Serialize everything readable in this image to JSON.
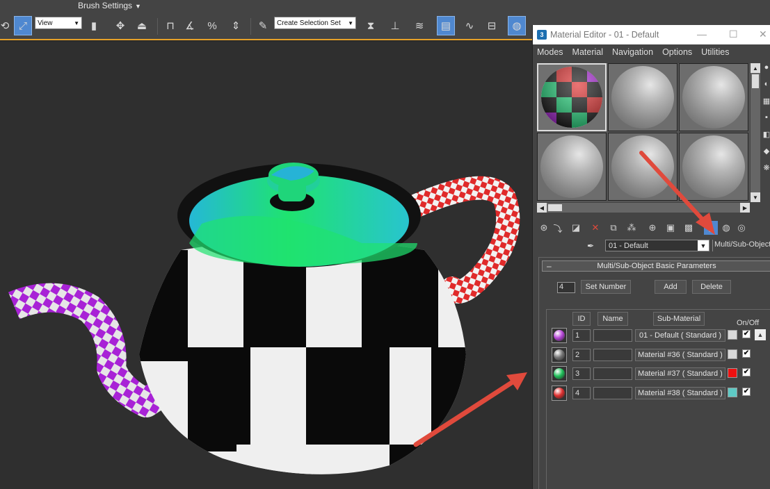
{
  "ribbon": {
    "brush_settings_label": "Brush Settings"
  },
  "toolbar": {
    "view_select": "View",
    "selection_set_select": "Create Selection Set"
  },
  "material_editor": {
    "title": "Material Editor - 01 - Default",
    "menu": [
      "Modes",
      "Material",
      "Navigation",
      "Options",
      "Utilities"
    ],
    "material_name": "01 - Default",
    "material_type": "Multi/Sub-Object",
    "rollout_title": "Multi/Sub-Object Basic Parameters",
    "num_materials": "4",
    "set_number_label": "Set Number",
    "add_label": "Add",
    "delete_label": "Delete",
    "columns": {
      "id": "ID",
      "name": "Name",
      "sub_material": "Sub-Material",
      "on_off": "On/Off"
    },
    "sub_materials": [
      {
        "id": "1",
        "name": "",
        "material": "01 - Default  ( Standard )",
        "color": "#d9d9d9",
        "thumb": "#b646d8",
        "on": "✔"
      },
      {
        "id": "2",
        "name": "",
        "material": "Material #36  ( Standard )",
        "color": "#d9d9d9",
        "thumb": "#777777",
        "on": "✔"
      },
      {
        "id": "3",
        "name": "",
        "material": "Material #37  ( Standard )",
        "color": "#ee1111",
        "thumb": "#20c05a",
        "on": "✔"
      },
      {
        "id": "4",
        "name": "",
        "material": "Material #38  ( Standard )",
        "color": "#5ec9c4",
        "thumb": "#e03030",
        "on": "✔"
      }
    ]
  },
  "colors": {
    "accent_blue": "#4f88d0",
    "arrow_red": "#e04a3c",
    "viewport_bg": "#2f2f2f"
  }
}
